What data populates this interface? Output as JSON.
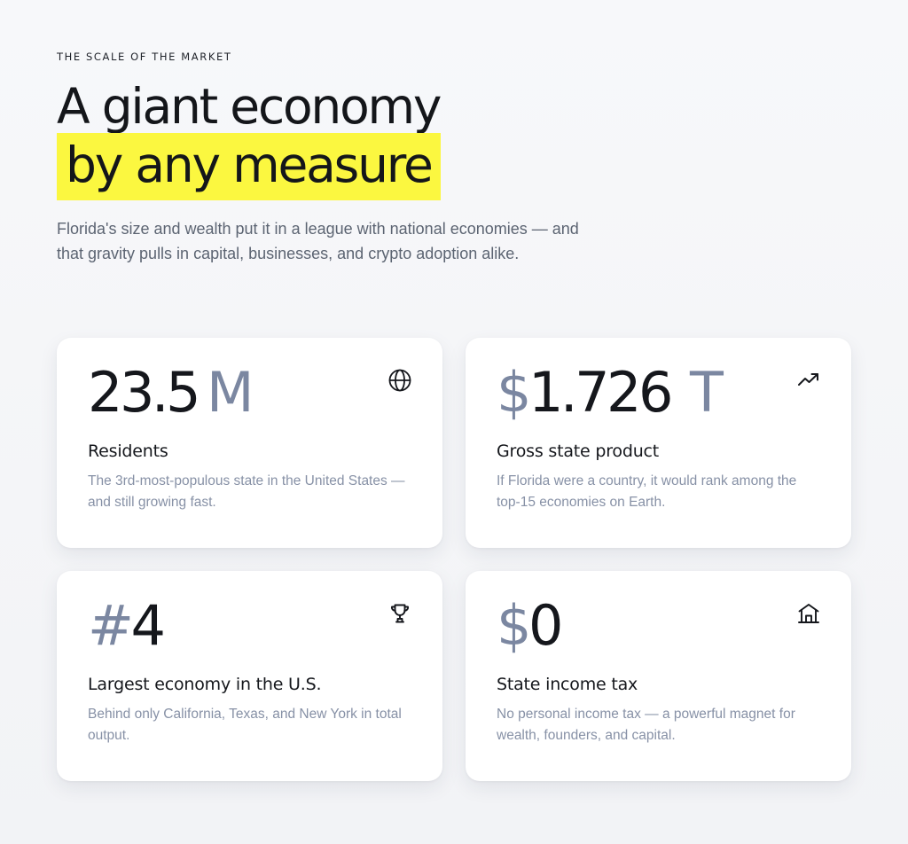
{
  "eyebrow": "THE SCALE OF THE MARKET",
  "headline": {
    "line1": "A giant economy",
    "highlight": "by any measure"
  },
  "subtitle": "Florida's size and wealth put it in a league with national economies — and that gravity pulls in capital, businesses, and crypto adoption alike.",
  "colors": {
    "highlight": "#fbf740",
    "muted_accent": "#7b87a1",
    "text": "#15171c",
    "description": "#8791a6"
  },
  "cards": [
    {
      "stat_main": "23.5",
      "stat_suffix": "M",
      "icon": "globe-icon",
      "title": "Residents",
      "description": "The 3rd-most-populous state in the United States — and still growing fast."
    },
    {
      "stat_prefix": "$",
      "stat_main": "1.726",
      "stat_suffix": "T",
      "icon": "trending-up-icon",
      "title": "Gross state product",
      "description": "If Florida were a country, it would rank among the top-15 economies on Earth."
    },
    {
      "stat_prefix": "#",
      "stat_main": "4",
      "icon": "trophy-icon",
      "title": "Largest economy in the U.S.",
      "description": "Behind only California, Texas, and New York in total output."
    },
    {
      "stat_prefix": "$",
      "stat_main": "0",
      "icon": "house-icon",
      "title": "State income tax",
      "description": "No personal income tax — a powerful magnet for wealth, founders, and capital."
    }
  ]
}
